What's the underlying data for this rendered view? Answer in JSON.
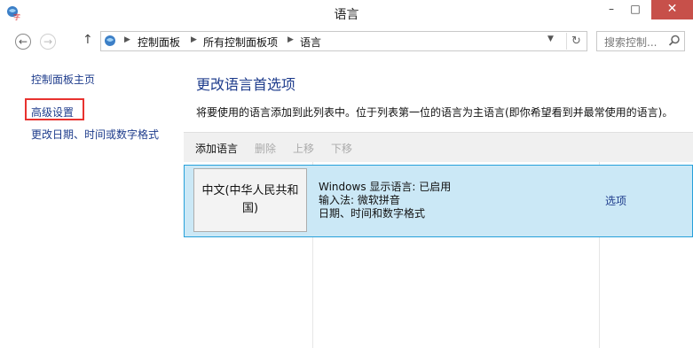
{
  "window": {
    "title": "语言",
    "minimize": "–",
    "maximize": "□",
    "close": "✕"
  },
  "nav": {
    "breadcrumbs": [
      "控制面板",
      "所有控制面板项",
      "语言"
    ],
    "search_placeholder": "搜索控制..."
  },
  "sidebar": {
    "items": [
      {
        "label": "控制面板主页"
      },
      {
        "label": "高级设置"
      },
      {
        "label": "更改日期、时间或数字格式"
      }
    ]
  },
  "main": {
    "title": "更改语言首选项",
    "description": "将要使用的语言添加到此列表中。位于列表第一位的语言为主语言(即你希望看到并最常使用的语言)。",
    "toolbar": {
      "add": "添加语言",
      "remove": "删除",
      "up": "上移",
      "down": "下移"
    },
    "languages": [
      {
        "name": "中文(中华人民共和国)",
        "line1": "Windows 显示语言: 已启用",
        "line2": "输入法: 微软拼音",
        "line3": "日期、时间和数字格式",
        "options": "选项"
      }
    ]
  },
  "colors": {
    "link": "#1e3c8c",
    "selection": "#cbe8f6",
    "highlight_border": "#e8322f",
    "close": "#c7504a"
  }
}
